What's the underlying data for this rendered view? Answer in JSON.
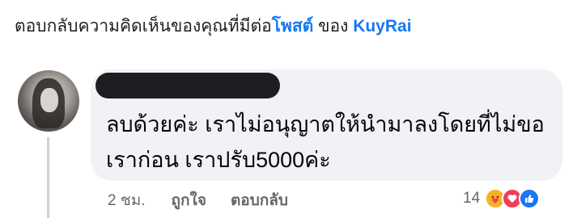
{
  "header": {
    "prefix": "ตอบกลับความคิดเห็นของคุณที่มีต่อ",
    "post_link": "โพสต์",
    "middle": " ของ ",
    "author_link": "KuyRai"
  },
  "comment": {
    "text": "ลบด้วยค่ะ เราไม่อนุญาตให้นำมาลงโดยที่ไม่ขอเราก่อน เราปรับ5000ค่ะ"
  },
  "actions": {
    "time": "2 ชม.",
    "like_label": "ถูกใจ",
    "reply_label": "ตอบกลับ"
  },
  "reactions": {
    "count": "14",
    "types": [
      "care-icon",
      "love-icon",
      "like-icon"
    ],
    "colors": {
      "care": "#f7b125",
      "love": "#f33e58",
      "like": "#1877f2"
    }
  },
  "colors": {
    "link": "#1877f2",
    "bubble": "#f0f2f5",
    "muted": "#65676b"
  }
}
